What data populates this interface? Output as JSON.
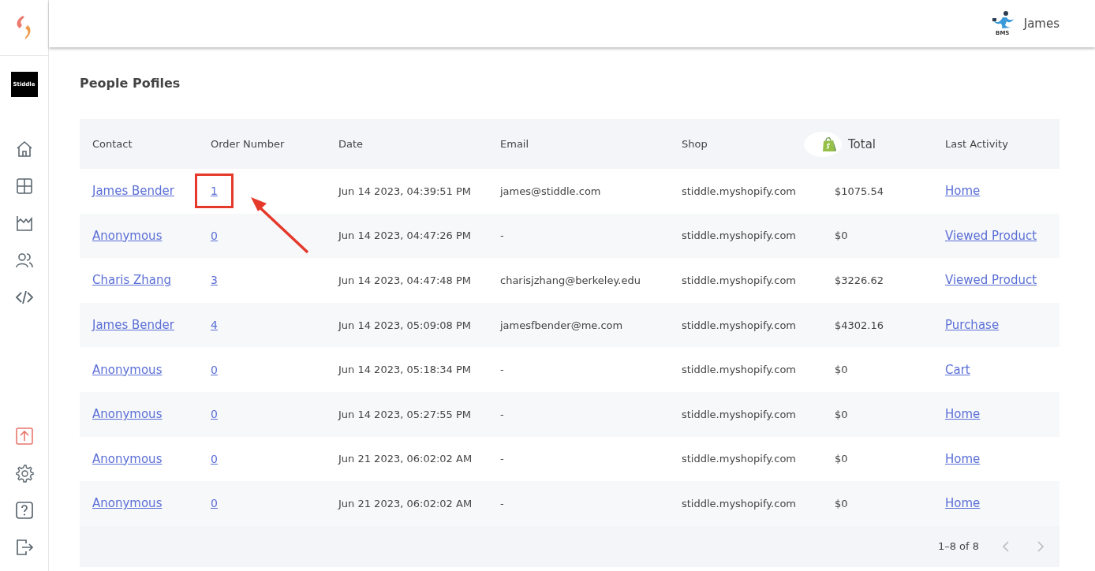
{
  "sidebar": {
    "brand_badge": "Stiddle",
    "nav": [
      {
        "selected": false
      },
      {
        "selected": false
      },
      {
        "selected": false
      },
      {
        "selected": false
      },
      {
        "selected": false
      }
    ],
    "bottom": [
      {
        "accent": true
      },
      {
        "accent": false
      },
      {
        "accent": false
      },
      {
        "accent": false
      }
    ]
  },
  "header": {
    "org": "BMS",
    "user": "James"
  },
  "page_title": "People Pofiles",
  "table": {
    "columns": [
      {
        "label": "Contact",
        "kind": "text"
      },
      {
        "label": "Order Number",
        "kind": "text"
      },
      {
        "label": "Date",
        "kind": "text"
      },
      {
        "label": "Email",
        "kind": "text"
      },
      {
        "label": "Shop",
        "kind": "text"
      },
      {
        "label": "Total",
        "kind": "shop-logo"
      },
      {
        "label": "Last Activity",
        "kind": "text"
      }
    ],
    "rows": [
      {
        "contact": "James Bender",
        "order": "1",
        "order_highlighted": true,
        "date": "Jun 14 2023, 04:39:51 PM",
        "email": "james@stiddle.com",
        "shop": "stiddle.myshopify.com",
        "total": "$1075.54",
        "last_activity": "Home"
      },
      {
        "contact": "Anonymous",
        "order": "0",
        "order_highlighted": false,
        "date": "Jun 14 2023, 04:47:26 PM",
        "email": "-",
        "shop": "stiddle.myshopify.com",
        "total": "$0",
        "last_activity": "Viewed Product"
      },
      {
        "contact": "Charis Zhang",
        "order": "3",
        "order_highlighted": false,
        "date": "Jun 14 2023, 04:47:48 PM",
        "email": "charisjzhang@berkeley.edu",
        "shop": "stiddle.myshopify.com",
        "total": "$3226.62",
        "last_activity": "Viewed Product"
      },
      {
        "contact": "James Bender",
        "order": "4",
        "order_highlighted": false,
        "date": "Jun 14 2023, 05:09:08 PM",
        "email": "jamesfbender@me.com",
        "shop": "stiddle.myshopify.com",
        "total": "$4302.16",
        "last_activity": "Purchase"
      },
      {
        "contact": "Anonymous",
        "order": "0",
        "order_highlighted": false,
        "date": "Jun 14 2023, 05:18:34 PM",
        "email": "-",
        "shop": "stiddle.myshopify.com",
        "total": "$0",
        "last_activity": "Cart"
      },
      {
        "contact": "Anonymous",
        "order": "0",
        "order_highlighted": false,
        "date": "Jun 14 2023, 05:27:55 PM",
        "email": "-",
        "shop": "stiddle.myshopify.com",
        "total": "$0",
        "last_activity": "Home"
      },
      {
        "contact": "Anonymous",
        "order": "0",
        "order_highlighted": false,
        "date": "Jun 21 2023, 06:02:02 AM",
        "email": "-",
        "shop": "stiddle.myshopify.com",
        "total": "$0",
        "last_activity": "Home"
      },
      {
        "contact": "Anonymous",
        "order": "0",
        "order_highlighted": false,
        "date": "Jun 21 2023, 06:02:02 AM",
        "email": "-",
        "shop": "stiddle.myshopify.com",
        "total": "$0",
        "last_activity": "Home"
      }
    ],
    "pagination": {
      "range": "1–8 of 8",
      "prev_disabled": true,
      "next_disabled": true
    }
  }
}
